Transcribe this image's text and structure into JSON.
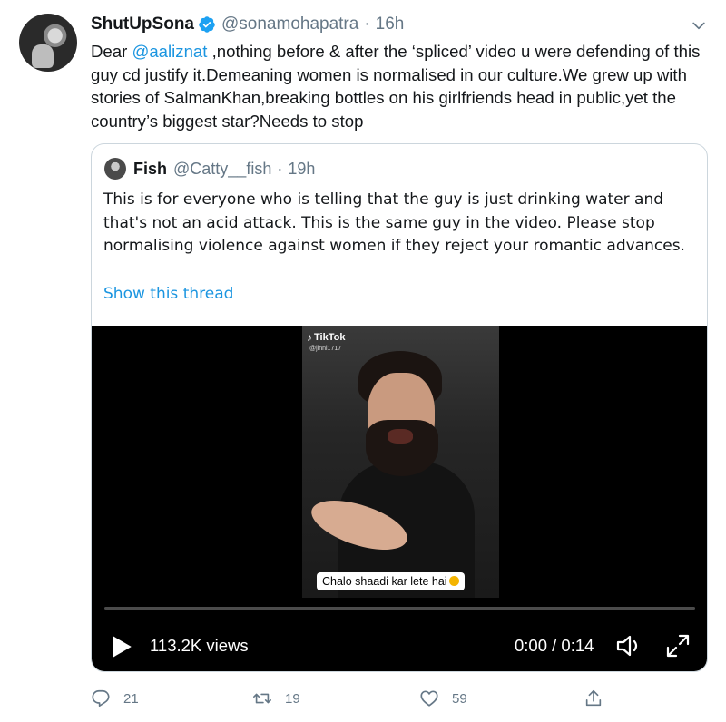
{
  "tweet": {
    "display_name": "ShutUpSona",
    "handle": "@sonamohapatra",
    "separator": "·",
    "time": "16h",
    "text_lead": "Dear ",
    "mention": "@aaliznat",
    "text_rest": " ,nothing before & after the ‘spliced’ video u were defending of this guy cd justify it.Demeaning women is normalised in our culture.We grew up with stories of SalmanKhan,breaking bottles on his girlfriends head in public,yet the country’s biggest star?Needs to stop"
  },
  "quoted": {
    "display_name": "Fish",
    "handle": "@Catty__fish",
    "separator": "·",
    "time": "19h",
    "text": "This is for everyone who is telling that the guy is just drinking water and that's not an acid attack. This is the same guy in the video. Please stop normalising violence against women if they reject your romantic advances.",
    "show_thread": "Show this thread"
  },
  "video": {
    "watermark": "TikTok",
    "watermark_user": "@jinni1717",
    "caption": "Chalo shaadi kar lete hai",
    "views": "113.2K views",
    "duration": "0:00 / 0:14",
    "progress": 0.0
  },
  "actions": {
    "replies": "21",
    "retweets": "19",
    "likes": "59"
  },
  "colors": {
    "accent": "#1da1f2",
    "link": "#1b95e0",
    "secondary_text": "#657786",
    "border": "#ccd6dd"
  },
  "icons": [
    "verified-badge-icon",
    "chevron-down-icon",
    "play-icon",
    "volume-icon",
    "fullscreen-icon",
    "reply-icon",
    "retweet-icon",
    "like-icon",
    "share-icon"
  ]
}
